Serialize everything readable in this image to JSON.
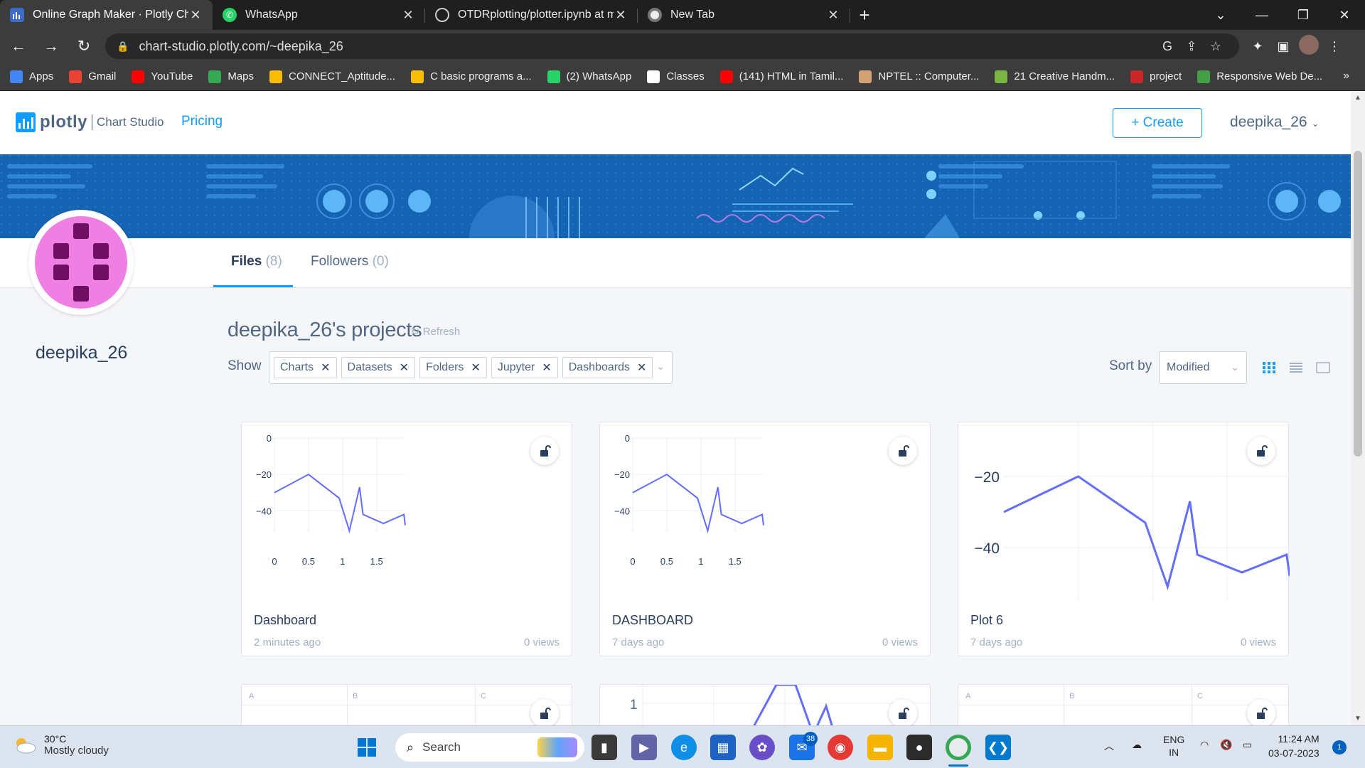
{
  "browser": {
    "tabs": [
      {
        "title": "Online Graph Maker · Plotly Char",
        "icon": "plotly-icon",
        "active": true
      },
      {
        "title": "WhatsApp",
        "icon": "whatsapp-icon",
        "active": false
      },
      {
        "title": "OTDRplotting/plotter.ipynb at m",
        "icon": "github-icon",
        "active": false
      },
      {
        "title": "New Tab",
        "icon": "chrome-icon",
        "active": false
      }
    ],
    "url": "chart-studio.plotly.com/~deepika_26",
    "bookmarks": [
      {
        "label": "Apps",
        "icon": "apps-grid-icon",
        "color": "#4285f4"
      },
      {
        "label": "Gmail",
        "icon": "gmail-icon",
        "color": "#ea4335"
      },
      {
        "label": "YouTube",
        "icon": "youtube-icon",
        "color": "#ff0000"
      },
      {
        "label": "Maps",
        "icon": "maps-icon",
        "color": "#34a853"
      },
      {
        "label": "CONNECT_Aptitude...",
        "icon": "drive-icon",
        "color": "#fbbc04"
      },
      {
        "label": "C basic programs a...",
        "icon": "drive-icon",
        "color": "#fbbc04"
      },
      {
        "label": "(2) WhatsApp",
        "icon": "whatsapp-icon",
        "color": "#25d366"
      },
      {
        "label": "Classes",
        "icon": "google-icon",
        "color": "#ffffff"
      },
      {
        "label": "(141) HTML in Tamil...",
        "icon": "youtube-icon",
        "color": "#ff0000"
      },
      {
        "label": "NPTEL :: Computer...",
        "icon": "nptel-icon",
        "color": "#d4a373"
      },
      {
        "label": "21 Creative Handm...",
        "icon": "scissors-icon",
        "color": "#7cb342"
      },
      {
        "label": "project",
        "icon": "project-icon",
        "color": "#c62828"
      },
      {
        "label": "Responsive Web De...",
        "icon": "w-icon",
        "color": "#43a047"
      }
    ],
    "bookmarks_more": "»"
  },
  "header": {
    "brand": "plotly",
    "product": "Chart Studio",
    "pricing": "Pricing",
    "create": "+ Create",
    "user": "deepika_26"
  },
  "profile": {
    "username": "deepika_26",
    "tabs": [
      {
        "label": "Files",
        "count": "(8)"
      },
      {
        "label": "Followers",
        "count": "(0)"
      }
    ]
  },
  "projects": {
    "title": "deepika_26's projects",
    "refresh": "Refresh",
    "show_label": "Show",
    "filters": [
      "Charts",
      "Datasets",
      "Folders",
      "Jupyter",
      "Dashboards"
    ],
    "sort_label": "Sort by",
    "sort_value": "Modified"
  },
  "cards": [
    {
      "name": "Dashboard",
      "when": "2 minutes ago",
      "views": "0 views"
    },
    {
      "name": "DASHBOARD",
      "when": "7 days ago",
      "views": "0 views"
    },
    {
      "name": "Plot 6",
      "when": "7 days ago",
      "views": "0 views"
    }
  ],
  "row2": {
    "grid1_cols": [
      "A",
      "B",
      "C"
    ],
    "chart_tick": "1",
    "grid2_cols": [
      "A",
      "B",
      "C"
    ]
  },
  "chart_data": [
    {
      "type": "line",
      "x": [
        0,
        0.5,
        0.95,
        1.1,
        1.25,
        1.3,
        1.6,
        1.9,
        1.92
      ],
      "y": [
        -30,
        -20,
        -33,
        -51,
        -27,
        -42,
        -47,
        -42,
        -48
      ],
      "xticks": [
        "0",
        "0.5",
        "1",
        "1.5"
      ],
      "yticks": [
        "0",
        "−20",
        "−40"
      ],
      "ylim": [
        -52,
        0
      ],
      "color": "#636efa"
    },
    {
      "type": "line",
      "x": [
        0,
        0.5,
        0.95,
        1.1,
        1.25,
        1.3,
        1.6,
        1.9,
        1.92
      ],
      "y": [
        -30,
        -20,
        -33,
        -51,
        -27,
        -42,
        -47,
        -42,
        -48
      ],
      "xticks": [
        "0",
        "0.5",
        "1",
        "1.5"
      ],
      "yticks": [
        "0",
        "−20",
        "−40"
      ],
      "ylim": [
        -52,
        0
      ],
      "color": "#636efa"
    },
    {
      "type": "line",
      "x": [
        0,
        0.5,
        0.95,
        1.1,
        1.25,
        1.3,
        1.6,
        1.9,
        1.92
      ],
      "y": [
        -30,
        -20,
        -33,
        -51,
        -27,
        -42,
        -47,
        -42,
        -48
      ],
      "yticks": [
        "−20",
        "−40"
      ],
      "color": "#636efa"
    }
  ],
  "taskbar": {
    "temp": "30°C",
    "weather": "Mostly cloudy",
    "search": "Search",
    "mail_badge": "38",
    "lang1": "ENG",
    "lang2": "IN",
    "time": "11:24 AM",
    "date": "03-07-2023",
    "notif": "1"
  }
}
